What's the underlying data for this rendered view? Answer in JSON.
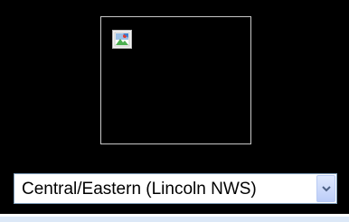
{
  "region_selector": {
    "selected_label": "Central/Eastern (Lincoln NWS)"
  },
  "image": {
    "icon": "broken-image-icon"
  },
  "icons": {
    "dropdown": "chevron-down-icon"
  }
}
